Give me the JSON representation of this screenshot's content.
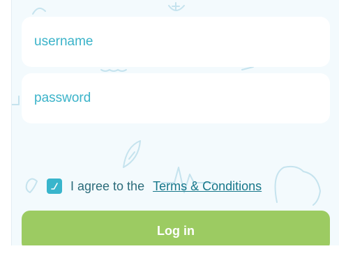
{
  "form": {
    "username_placeholder": "username",
    "password_placeholder": "password",
    "agree_checked": true,
    "agree_text": "I agree to the",
    "terms_link": "Terms & Conditions",
    "login_label": "Log in"
  },
  "colors": {
    "panel_bg": "#f3fafd",
    "accent_teal": "#39b5cc",
    "button_green": "#9ccb62",
    "doodle": "#c5e3ee"
  },
  "icons": [
    "check-icon",
    "leaf-doodle-icon",
    "heartbeat-doodle-icon",
    "hand-doodle-icon"
  ]
}
